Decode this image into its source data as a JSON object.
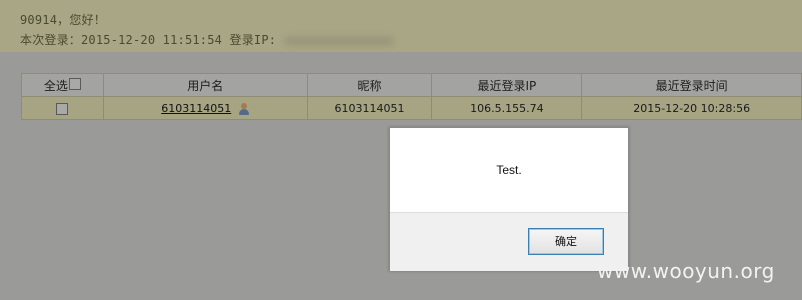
{
  "header": {
    "greeting": "90914，您好！",
    "login_label": "本次登录：2015-12-20 11:51:54 登录IP:"
  },
  "table": {
    "columns": {
      "select_all": "全选",
      "username": "用户名",
      "nickname": "昵称",
      "last_login_ip": "最近登录IP",
      "last_login_time": "最近登录时间"
    },
    "rows": [
      {
        "username": "6103114051",
        "nickname": "6103114051",
        "last_login_ip": "106.5.155.74",
        "last_login_time": "2015-12-20 10:28:56"
      }
    ]
  },
  "dialog": {
    "message": "Test.",
    "ok_label": "确定"
  },
  "watermark": {
    "text": "www.wooyun.org"
  },
  "icons": {
    "user": "user-icon"
  },
  "colors": {
    "banner_bg": "#a8a684",
    "row_bg": "#a6a482",
    "header_bg": "#a3a3a1",
    "overlay_bg": "#9a9a98",
    "dialog_bg": "#ffffff",
    "button_border": "#3c7fb1"
  }
}
